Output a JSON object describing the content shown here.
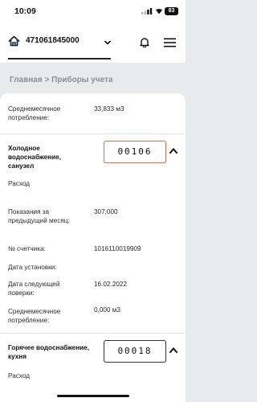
{
  "status": {
    "time": "10:09",
    "battery": "83"
  },
  "header": {
    "account": "471061845000",
    "home_icon": "home-icon",
    "bell_icon": "bell-icon",
    "menu_icon": "hamburger-icon"
  },
  "breadcrumb": "Главная > Приборы учета",
  "section0": {
    "avg_label": "Среднемесячное потребление:",
    "avg_value": "33,833 м3"
  },
  "cold": {
    "title": "Холодное водоснабжение, санузел",
    "reading": "00106",
    "expense_label": "Расход",
    "prev_label": "Показания за предыдущий месяц:",
    "prev_value": "307,000",
    "number_label": "№ счетчика:",
    "number_value": "1016110019909",
    "install_label": "Дата установки:",
    "next_check_label": "Дата следующей поверки:",
    "next_check_value": "16.02.2022",
    "avg_label": "Среднемесячное потребление:",
    "avg_value": "0,000 м3"
  },
  "hot": {
    "title": "Горячее водоснабжение, кухня",
    "reading": "00018",
    "expense_label": "Расход"
  }
}
